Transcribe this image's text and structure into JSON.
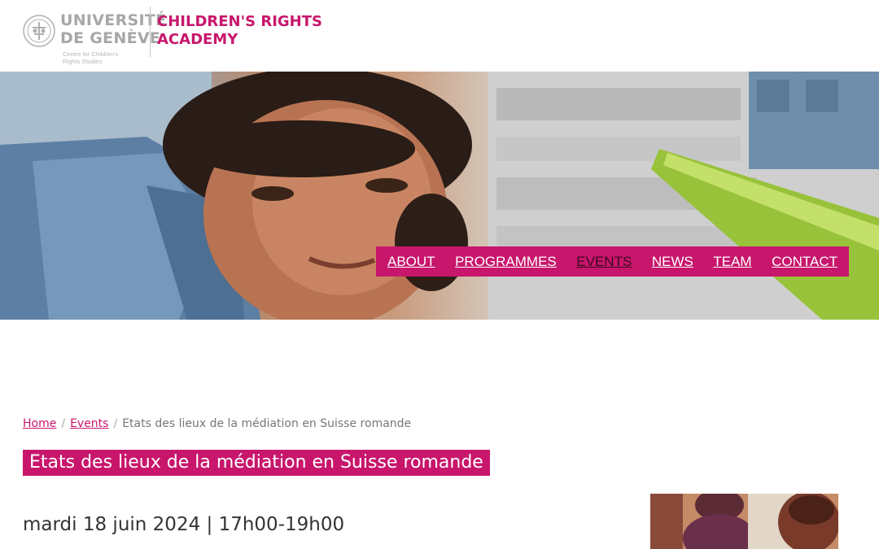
{
  "header": {
    "university_line1": "UNIVERSITÉ",
    "university_line2": "DE GENÈVE",
    "centre_line1": "Centre for Children's",
    "centre_line2": "Rights Studies",
    "academy_line1": "CHILDREN'S RIGHTS",
    "academy_line2": "ACADEMY"
  },
  "nav": {
    "items": [
      {
        "label": "ABOUT"
      },
      {
        "label": "PROGRAMMES"
      },
      {
        "label": "EVENTS",
        "active": true
      },
      {
        "label": "NEWS"
      },
      {
        "label": "TEAM"
      },
      {
        "label": "CONTACT"
      }
    ]
  },
  "breadcrumb": {
    "home": "Home",
    "sep": "/",
    "events": "Events",
    "current": "Etats des lieux de la médiation en Suisse romande"
  },
  "page": {
    "title": "Etats des lieux de la médiation en Suisse romande",
    "date": "mardi 18 juin 2024 | 17h00-19h00"
  },
  "colors": {
    "brand": "#c8166c",
    "nav_active": "#3a0a22",
    "logo_grey": "#a7a7a7"
  }
}
